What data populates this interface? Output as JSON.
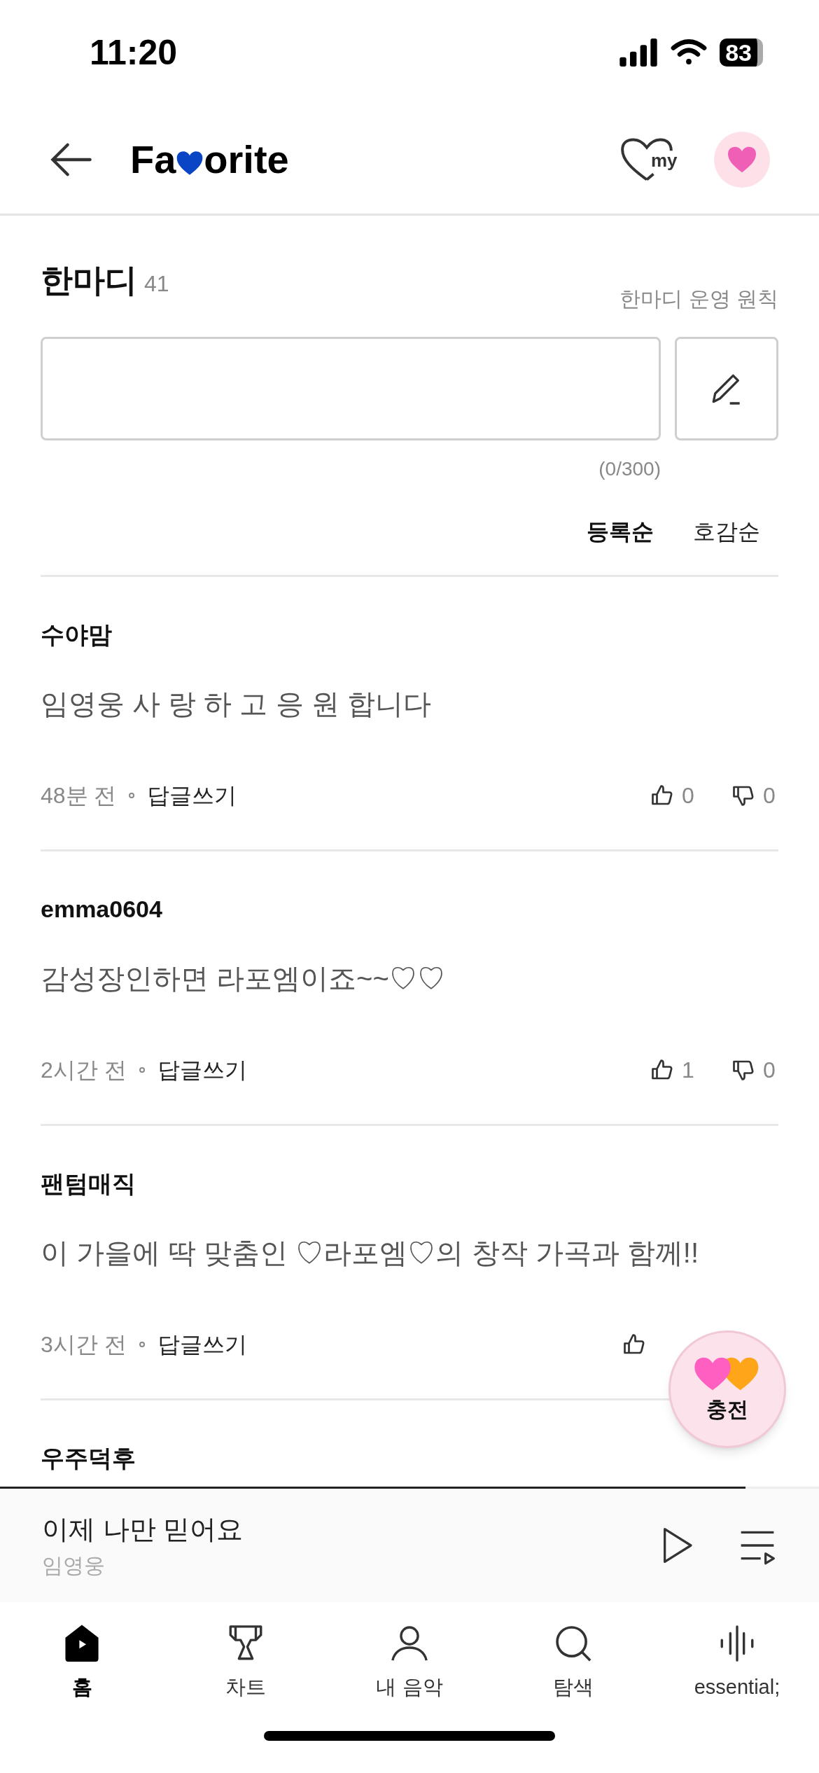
{
  "status_bar": {
    "time": "11:20",
    "battery": "83"
  },
  "header": {
    "logo_before": "Fa",
    "logo_after": "orite",
    "my_label": "my"
  },
  "section": {
    "title": "한마디",
    "count": "41",
    "rules_link": "한마디 운영 원칙",
    "counter": "(0/300)"
  },
  "sort_tabs": [
    {
      "label": "등록순",
      "selected": true
    },
    {
      "label": "호감순",
      "selected": false
    }
  ],
  "comments": [
    {
      "author": "수야맘",
      "text": "임영웅 사 랑 하 고 응 원 합니다",
      "time": "48분 전",
      "reply": "답글쓰기",
      "likes": "0",
      "dislikes": "0"
    },
    {
      "author": "emma0604",
      "text": "감성장인하면 라포엠이죠~~♡♡",
      "time": "2시간 전",
      "reply": "답글쓰기",
      "likes": "1",
      "dislikes": "0"
    },
    {
      "author": "팬텀매직",
      "text": "이 가을에 딱 맞춤인 ♡라포엠♡의 창작 가곡과 함께!!",
      "time": "3시간 전",
      "reply": "답글쓰기"
    },
    {
      "author": "우주덕후"
    }
  ],
  "charge_button": {
    "label": "충전"
  },
  "player": {
    "title": "이제 나만 믿어요",
    "artist": "임영웅",
    "level": 0.91
  },
  "nav": [
    {
      "label": "홈",
      "kind": "home",
      "selected": true
    },
    {
      "label": "차트",
      "kind": "chart",
      "selected": false
    },
    {
      "label": "내 음악",
      "kind": "mymusic",
      "selected": false
    },
    {
      "label": "탐색",
      "kind": "search",
      "selected": false
    },
    {
      "label": "essential;",
      "kind": "essential",
      "selected": false
    }
  ]
}
